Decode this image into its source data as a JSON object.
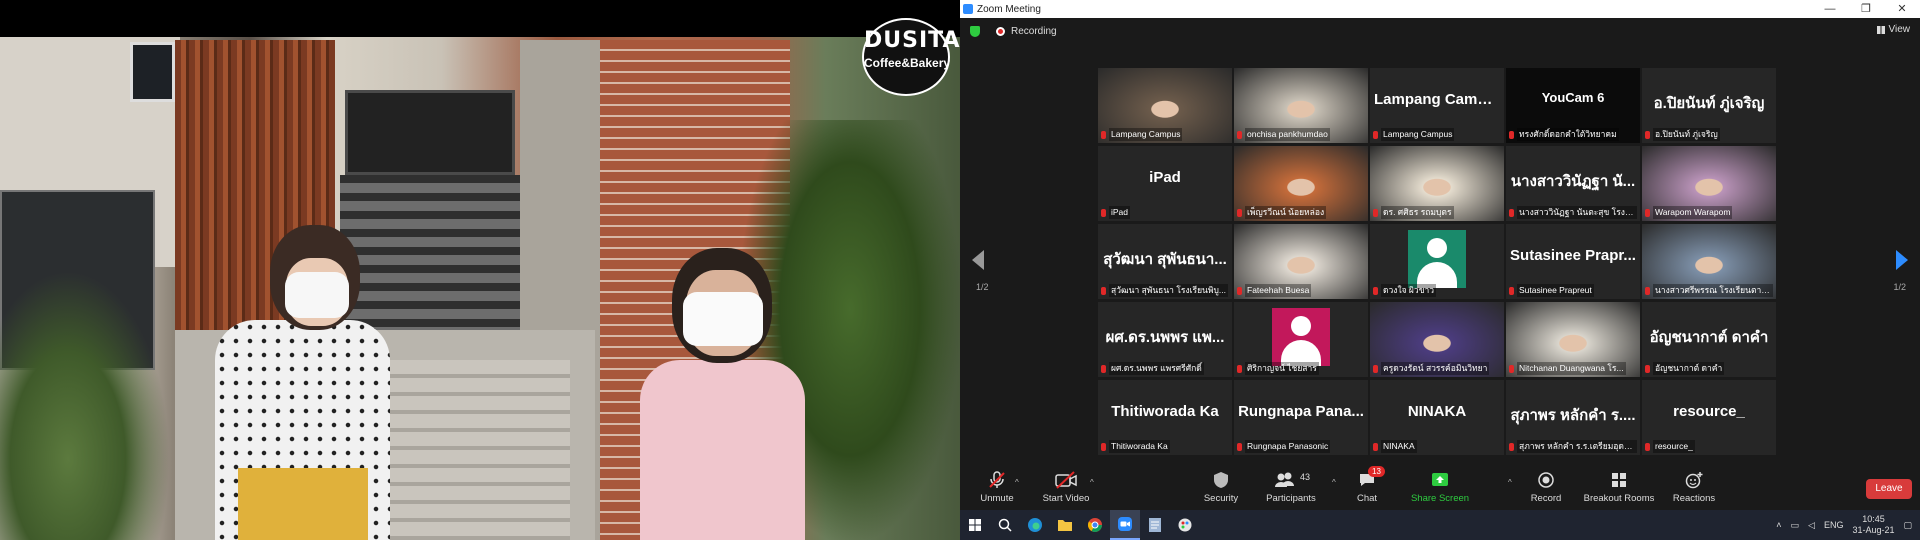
{
  "window": {
    "title": "Zoom Meeting",
    "controls": [
      "—",
      "❐",
      "✕"
    ]
  },
  "video": {
    "logo_main": "DUSITA",
    "logo_sub": "Coffee&Bakery"
  },
  "meeting": {
    "recording_label": "Recording",
    "view_label": "View",
    "page_left": "1/2",
    "page_right": "1/2"
  },
  "tiles": [
    {
      "label": "Lampang Campus",
      "kind": "video",
      "active": true,
      "bg": "#6b5a4a"
    },
    {
      "label": "onchisa pankhumdao",
      "kind": "video",
      "bg": "#c9c2b6"
    },
    {
      "label": "Lampang Campus",
      "kind": "name",
      "big": "Lampang Campus"
    },
    {
      "label": "ทรงศักดิ์ดอกคำใต้วิทยาคม",
      "kind": "youcam",
      "big": "YouCam 6"
    },
    {
      "label": "อ.ปิยนันท์ ภู่เจริญ",
      "kind": "name",
      "big": "อ.ปิยนันท์ ภู่เจริญ"
    },
    {
      "label": "iPad",
      "kind": "name",
      "big": "iPad"
    },
    {
      "label": "เพ็ญรวีณน์ น้อยหล่อง",
      "kind": "video",
      "bg": "#c46b3a"
    },
    {
      "label": "ดร. ศศิธร รถมบุตร",
      "kind": "video",
      "bg": "#e4dccd"
    },
    {
      "label": "นางสาววินัฏฐา นันตะสุข โรงเรี...",
      "kind": "name",
      "big": "นางสาววินัฏฐา นั..."
    },
    {
      "label": "Warapom Warapom",
      "kind": "video",
      "bg": "#b993b8"
    },
    {
      "label": "สุวัฒนา สุพันธนา โรงเรียนพิบู...",
      "kind": "name",
      "big": "สุวัฒนา สุพันธนา..."
    },
    {
      "label": "Fateehah Buesa",
      "kind": "video",
      "bg": "#ded8cf"
    },
    {
      "label": "ดวงใจ ผิวขาว",
      "kind": "avatar",
      "bg": "#1a8a6b"
    },
    {
      "label": "Sutasinee Prapreut",
      "kind": "name",
      "big": "Sutasinee Prapr..."
    },
    {
      "label": "นางสาวศรีพรรณ โรงเรียนตาร...",
      "kind": "video",
      "bg": "#7c8fa6"
    },
    {
      "label": "ผศ.ดร.นพพร แพรศรีศักดิ์",
      "kind": "name",
      "big": "ผศ.ดร.นพพร แพ..."
    },
    {
      "label": "ศิริกาญจน์ ไชยสาร",
      "kind": "avatar",
      "bg": "#c2185b"
    },
    {
      "label": "ครูดวงรัตน์ สวรรค์อมินวิทยา",
      "kind": "video",
      "bg": "#4b3c7e"
    },
    {
      "label": "Nitchanan Duangwana โร...",
      "kind": "video",
      "bg": "#d9d5cc"
    },
    {
      "label": "อัญชนากาต์ ดาคำ",
      "kind": "name",
      "big": "อัญชนากาต์ ดาคำ"
    },
    {
      "label": "Thitiworada Ka",
      "kind": "name",
      "big": "Thitiworada Ka"
    },
    {
      "label": "Rungnapa Panasonic",
      "kind": "name",
      "big": "Rungnapa Pana..."
    },
    {
      "label": "NINAKA",
      "kind": "name",
      "big": "NINAKA"
    },
    {
      "label": "สุภาพร หลักคำ ร.ร.เตรียมอุดม...",
      "kind": "name",
      "big": "สุภาพร หลักคำ ร...."
    },
    {
      "label": "resource_",
      "kind": "name",
      "big": "resource_"
    }
  ],
  "toolbar": {
    "unmute": "Unmute",
    "start_video": "Start Video",
    "security": "Security",
    "participants": "Participants",
    "participants_count": "43",
    "chat": "Chat",
    "chat_badge": "13",
    "share_screen": "Share Screen",
    "record": "Record",
    "breakout": "Breakout Rooms",
    "reactions": "Reactions",
    "leave": "Leave"
  },
  "taskbar": {
    "lang": "ENG",
    "time": "10:45",
    "date": "31-Aug-21"
  },
  "colors": {
    "accent": "#2d8cff",
    "share_green": "#2ecc40",
    "leave_red": "#d83b3b",
    "active_outline": "#e6d94b"
  }
}
